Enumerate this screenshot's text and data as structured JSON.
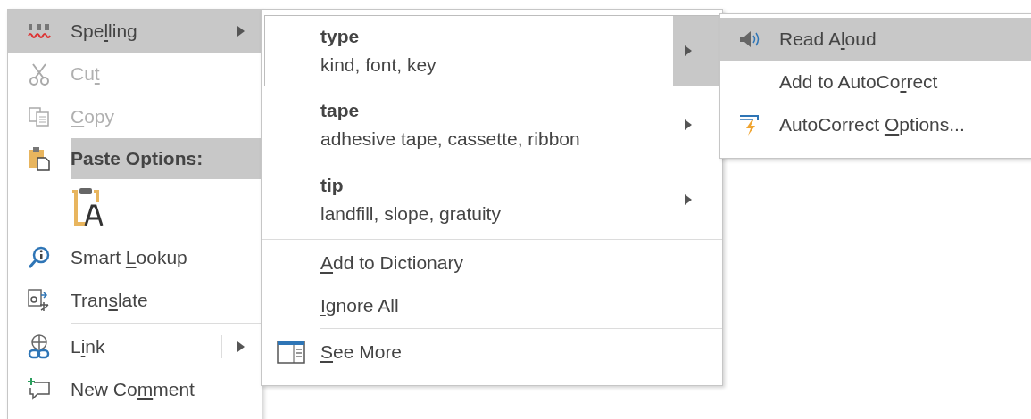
{
  "context_menu": {
    "items": [
      {
        "kind": "item",
        "label": {
          "before": "Spe",
          "key": "l",
          "after": "ling"
        },
        "submenu": true,
        "selected": true,
        "disabled": false
      },
      {
        "kind": "item",
        "label": {
          "before": "Cu",
          "key": "t"
        },
        "submenu": false,
        "selected": false,
        "disabled": true
      },
      {
        "kind": "item",
        "label": {
          "key": "C",
          "after": "opy"
        },
        "submenu": false,
        "selected": false,
        "disabled": true
      },
      {
        "kind": "heading",
        "label": {
          "before": "Paste Options:"
        },
        "selected": true
      },
      {
        "kind": "paste_option"
      },
      {
        "kind": "separator"
      },
      {
        "kind": "item",
        "label": {
          "before": "Smart ",
          "key": "L",
          "after": "ookup"
        },
        "submenu": false,
        "selected": false,
        "disabled": false
      },
      {
        "kind": "item",
        "label": {
          "before": "Tran",
          "key": "s",
          "after": "late"
        },
        "submenu": false,
        "selected": false,
        "disabled": false
      },
      {
        "kind": "separator"
      },
      {
        "kind": "item",
        "label": {
          "before": "L",
          "key": "i",
          "after": "nk"
        },
        "submenu": true,
        "selected": false,
        "disabled": false
      },
      {
        "kind": "item",
        "label": {
          "before": "New Co",
          "key": "m",
          "after": "ment"
        },
        "submenu": false,
        "selected": false,
        "disabled": false
      }
    ]
  },
  "spelling_menu": {
    "items": [
      {
        "kind": "suggestion",
        "word": "type",
        "synonyms": "kind, font, key",
        "selected": true
      },
      {
        "kind": "suggestion",
        "word": "tape",
        "synonyms": "adhesive tape, cassette, ribbon",
        "selected": false
      },
      {
        "kind": "suggestion",
        "word": "tip",
        "synonyms": "landfill, slope, gratuity",
        "selected": false
      },
      {
        "kind": "separator"
      },
      {
        "kind": "item",
        "label": {
          "key": "A",
          "after": "dd to Dictionary"
        },
        "selected": false
      },
      {
        "kind": "item",
        "label": {
          "key": "I",
          "after": "gnore All"
        },
        "selected": false
      },
      {
        "kind": "separator"
      },
      {
        "kind": "item",
        "label": {
          "key": "S",
          "after": "ee More"
        },
        "selected": false
      }
    ]
  },
  "suggestion_menu": {
    "items": [
      {
        "label": {
          "before": "Read A",
          "key": "l",
          "after": "oud"
        },
        "selected": true
      },
      {
        "label": {
          "before": "Add to AutoCo",
          "key": "r",
          "after": "rect"
        },
        "selected": false
      },
      {
        "label": {
          "before": "AutoCorrect ",
          "key": "O",
          "after": "ptions..."
        },
        "selected": false
      }
    ]
  }
}
